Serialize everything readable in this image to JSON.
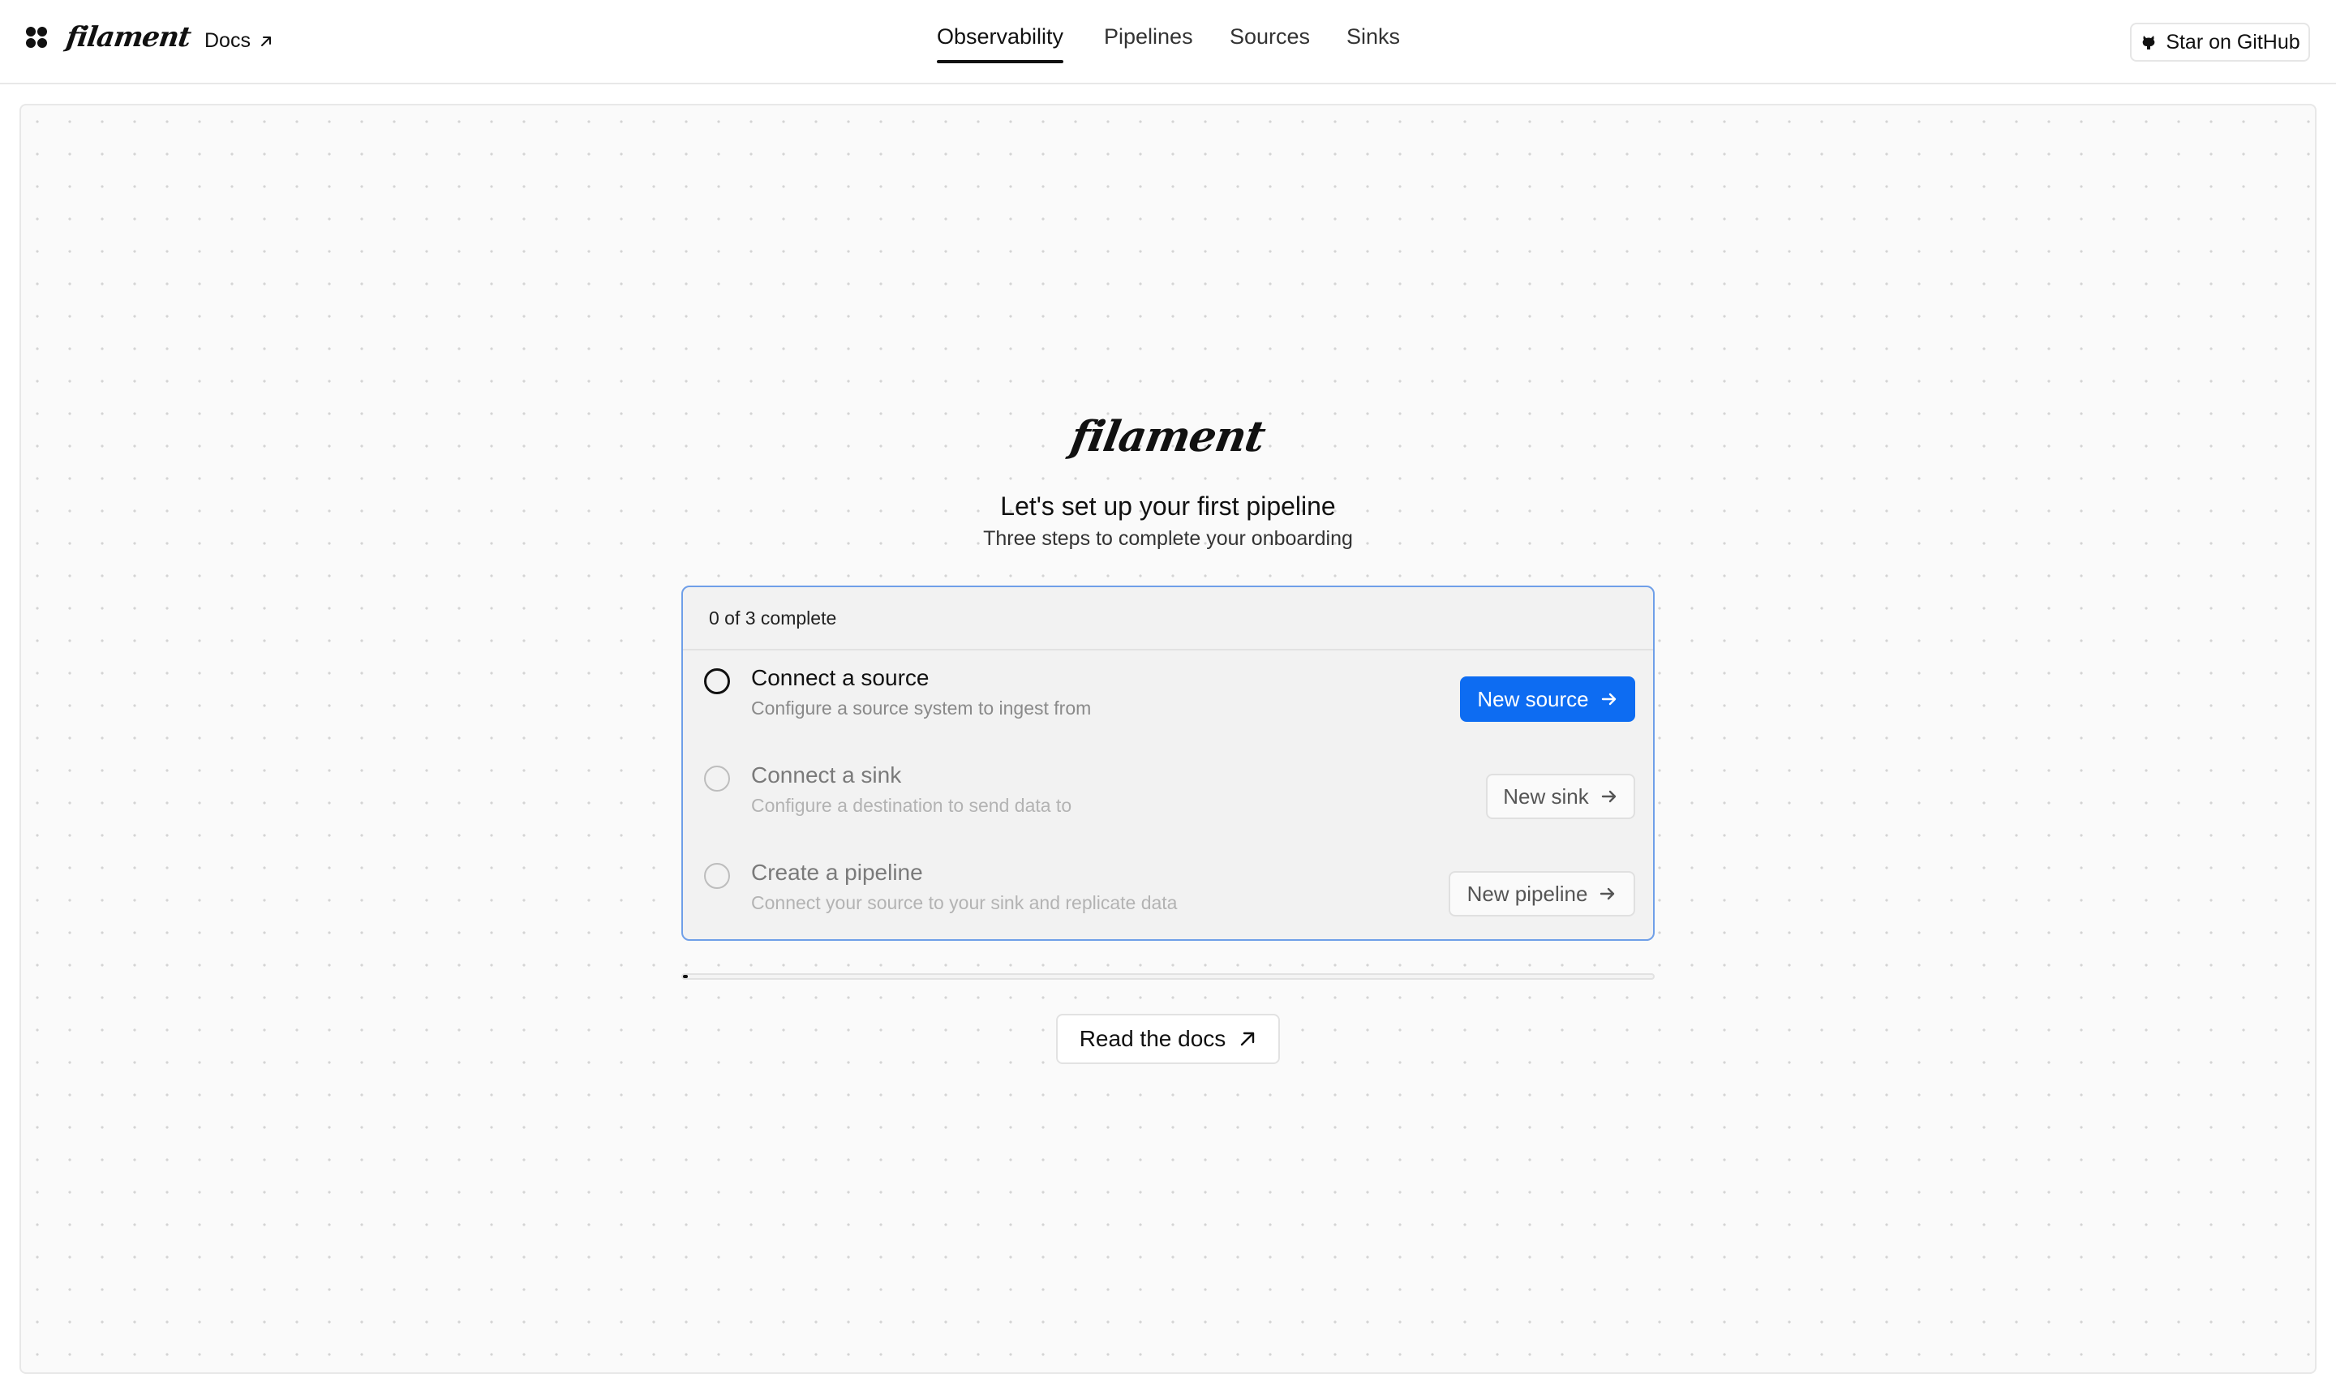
{
  "header": {
    "brand": "filament",
    "docs_label": "Docs",
    "tabs": [
      {
        "label": "Observability",
        "active": true
      },
      {
        "label": "Pipelines",
        "active": false
      },
      {
        "label": "Sources",
        "active": false
      },
      {
        "label": "Sinks",
        "active": false
      }
    ],
    "github_label": "Star on GitHub"
  },
  "onboarding": {
    "logo": "filament",
    "title": "Let's set up your first pipeline",
    "subtitle": "Three steps to complete your onboarding",
    "progress_text": "0 of 3 complete",
    "progress_fraction": 0,
    "steps": [
      {
        "title": "Connect a source",
        "description": "Configure a source system to ingest from",
        "button": "New source",
        "state": "current"
      },
      {
        "title": "Connect a sink",
        "description": "Configure a destination to send data to",
        "button": "New sink",
        "state": "pending"
      },
      {
        "title": "Create a pipeline",
        "description": "Connect your source to your sink and replicate data",
        "button": "New pipeline",
        "state": "pending"
      }
    ],
    "docs_button": "Read the docs"
  },
  "colors": {
    "accent": "#0d6cf2",
    "card_border": "#6f9fe8"
  },
  "icons": {
    "brand_mark": "clover-mark-icon",
    "external": "arrow-up-right-icon",
    "github": "github-icon",
    "next": "arrow-right-icon",
    "step_status": "radio-circle-icon"
  }
}
